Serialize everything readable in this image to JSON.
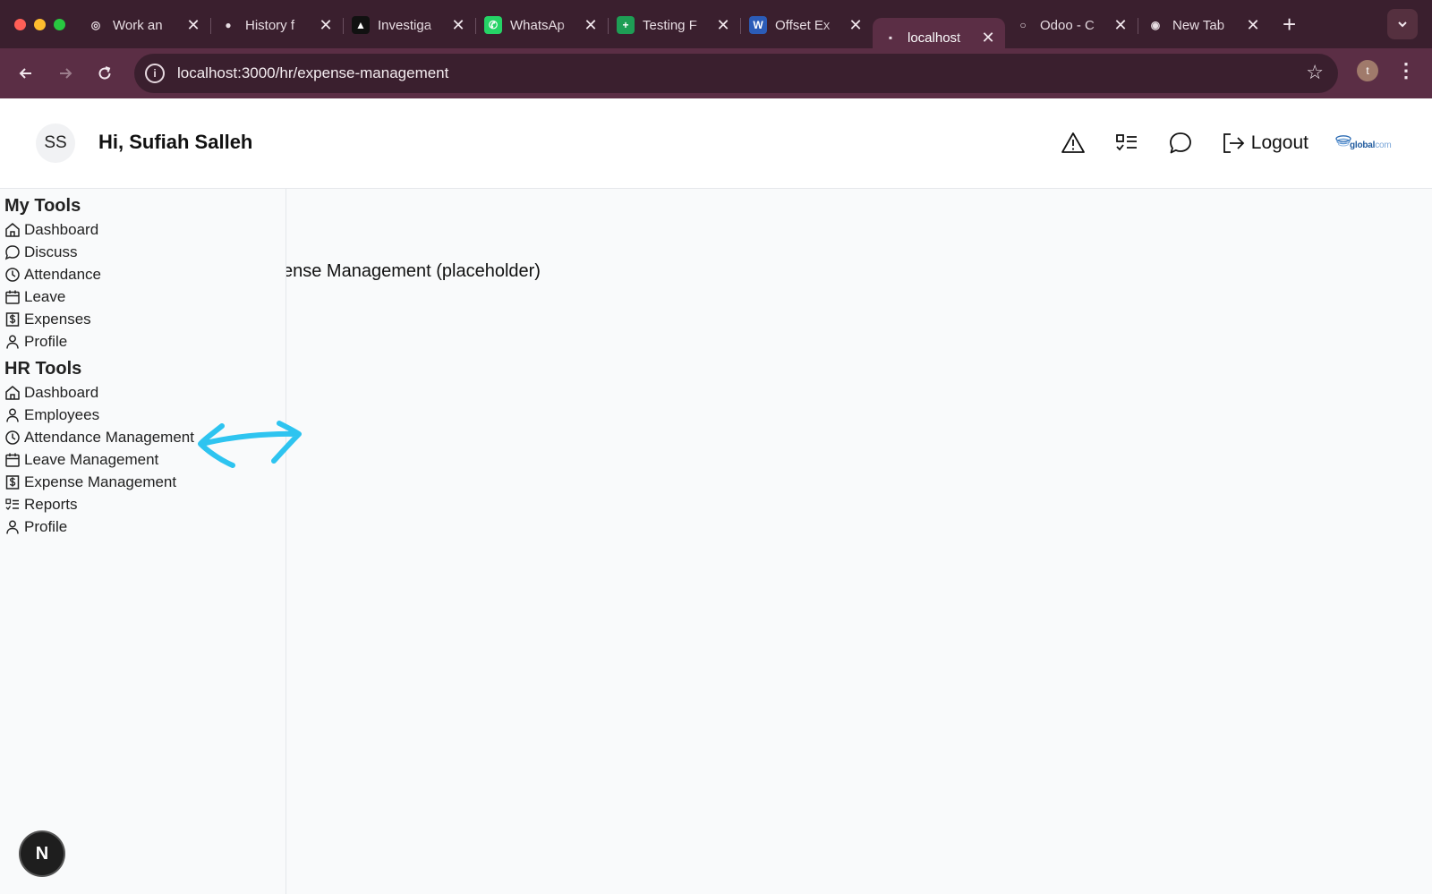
{
  "browser": {
    "traffic_colors": [
      "#ff5f57",
      "#febc2e",
      "#28c840"
    ],
    "tabs": [
      {
        "title": "Work an",
        "icon": "openai-icon",
        "icon_color": "#3a1f2e",
        "active": false
      },
      {
        "title": "History f",
        "icon": "github-icon",
        "icon_color": "#3a1f2e",
        "active": false
      },
      {
        "title": "Investiga",
        "icon": "dark-app-icon",
        "icon_color": "#111111",
        "active": false
      },
      {
        "title": "WhatsAp",
        "icon": "whatsapp-icon",
        "icon_color": "#25d366",
        "active": false
      },
      {
        "title": "Testing F",
        "icon": "sheets-icon",
        "icon_color": "#1e9e55",
        "active": false
      },
      {
        "title": "Offset Ex",
        "icon": "word-icon",
        "icon_color": "#2b5cb8",
        "active": false
      },
      {
        "title": "localhost",
        "icon": "localhost-icon",
        "icon_color": "#5b2e45",
        "active": true
      },
      {
        "title": "Odoo - C",
        "icon": "odoo-icon",
        "icon_color": "#3a1f2e",
        "active": false
      },
      {
        "title": "New Tab",
        "icon": "chrome-icon",
        "icon_color": "#3a1f2e",
        "active": false
      }
    ],
    "close_glyph": "✕",
    "new_tab_glyph": "+",
    "url": "localhost:3000/hr/expense-management",
    "profile_initial": "t"
  },
  "header": {
    "avatar_initials": "SS",
    "greeting": "Hi, Sufiah Salleh",
    "logout_label": "Logout",
    "logo_text_bold": "global",
    "logo_text_light": "com"
  },
  "sidebar": {
    "my_tools": {
      "title": "My Tools",
      "items": [
        {
          "label": "Dashboard",
          "icon": "home-icon"
        },
        {
          "label": "Discuss",
          "icon": "chat-bubble-icon"
        },
        {
          "label": "Attendance",
          "icon": "clock-icon"
        },
        {
          "label": "Leave",
          "icon": "calendar-icon"
        },
        {
          "label": "Expenses",
          "icon": "dollar-receipt-icon"
        },
        {
          "label": "Profile",
          "icon": "user-icon"
        }
      ]
    },
    "hr_tools": {
      "title": "HR Tools",
      "items": [
        {
          "label": "Dashboard",
          "icon": "home-icon"
        },
        {
          "label": "Employees",
          "icon": "user-icon"
        },
        {
          "label": "Attendance Management",
          "icon": "clock-icon"
        },
        {
          "label": "Leave Management",
          "icon": "calendar-icon"
        },
        {
          "label": "Expense Management",
          "icon": "dollar-receipt-icon"
        },
        {
          "label": "Reports",
          "icon": "checklist-icon"
        },
        {
          "label": "Profile",
          "icon": "user-icon"
        }
      ]
    }
  },
  "main": {
    "placeholder_text": "ense Management (placeholder)"
  },
  "annotation": {
    "color": "#2ec4f0"
  },
  "fab": {
    "label": "N"
  }
}
